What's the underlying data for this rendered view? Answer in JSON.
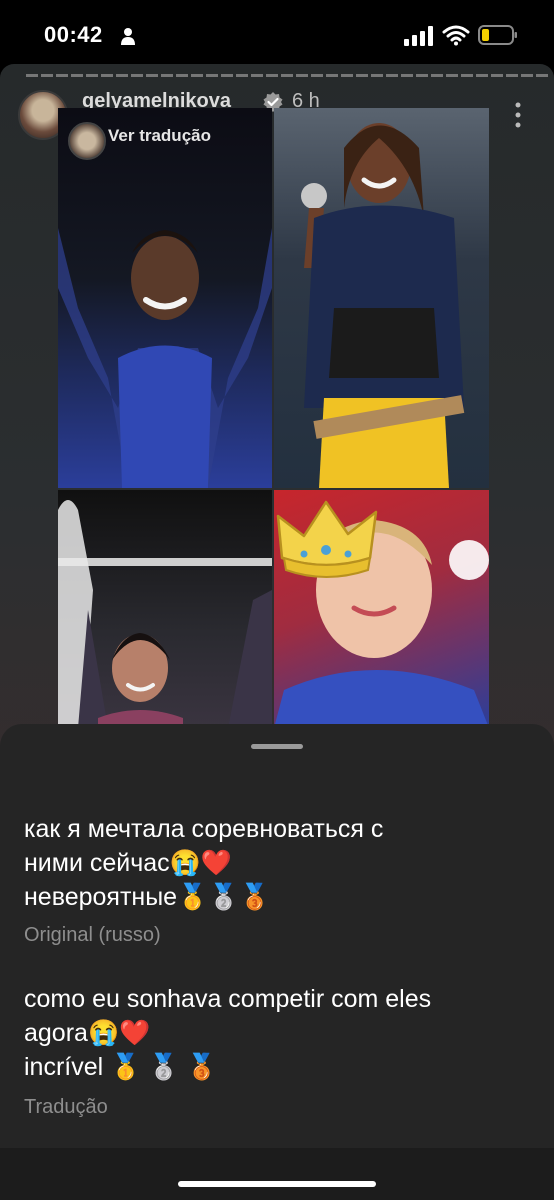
{
  "status_bar": {
    "time": "00:42"
  },
  "story": {
    "username": "gelyamelnikova",
    "time_ago": "6 h",
    "translate_label": "Ver tradução"
  },
  "sheet": {
    "original_lines": [
      "как я мечтала соревноваться с",
      "ними сейчас😭❤️",
      "невероятные🥇🥈🥉"
    ],
    "original_language": "Original (russo)",
    "translated_lines": [
      "como eu sonhava competir com eles",
      "agora😭❤️",
      "incrível 🥇 🥈 🥉"
    ],
    "translation_label": "Tradução"
  },
  "colors": {
    "background": "#000000",
    "sheet": "#252525",
    "muted_text": "#8e8e8e",
    "crown": "#f3d34a"
  }
}
